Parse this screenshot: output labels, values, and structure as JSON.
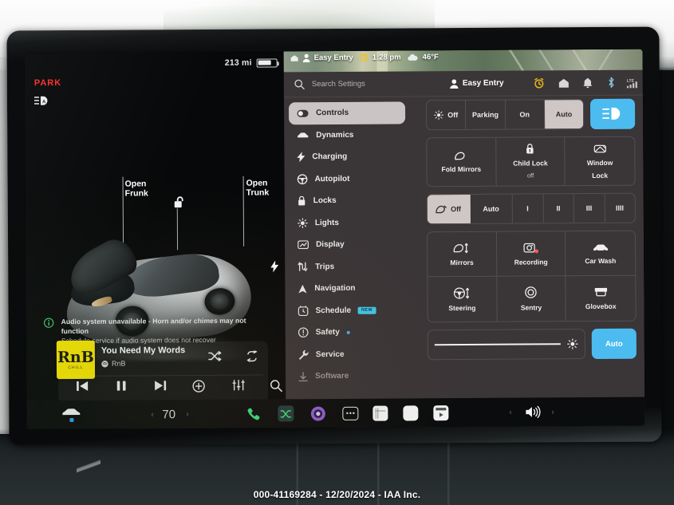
{
  "photo": {
    "watermark": "000-41169284 - 12/20/2024 - IAA Inc."
  },
  "drive_panel": {
    "range": "213 mi",
    "gear": "PARK",
    "autolight_icon": "auto-highbeam-icon",
    "battery_icon": "battery-icon",
    "charge_port_icon": "charge-bolt-icon",
    "labels": {
      "frunk_line1": "Open",
      "frunk_line2": "Frunk",
      "trunk_line1": "Open",
      "trunk_line2": "Trunk",
      "lock_icon": "lock-icon"
    },
    "notice": {
      "icon": "info-icon",
      "title": "Audio system unavailable - Horn and/or chimes may not function",
      "subtitle": "Schedule service if audio system does not recover"
    },
    "media": {
      "album_art_text": "RnB",
      "album_art_sub": "CHILL",
      "track_title": "You Need My Words",
      "source": "RnB",
      "source_icon": "spotify-icon",
      "shuffle_icon": "shuffle-icon",
      "repeat_icon": "repeat-icon",
      "prev_icon": "previous-track-icon",
      "pause_icon": "pause-icon",
      "next_icon": "next-track-icon",
      "add_icon": "add-circle-icon",
      "equalizer_icon": "equalizer-icon",
      "search_icon": "search-icon"
    }
  },
  "settings": {
    "map_status": {
      "place_icon": "place-icon",
      "person_icon": "person-icon",
      "profile": "Easy Entry",
      "clock_icon": "alarm-clock-icon",
      "time": "1:28 pm",
      "weather_icon": "cloud-icon",
      "temperature": "46°F"
    },
    "search": {
      "icon": "search-icon",
      "placeholder": "Search Settings"
    },
    "profile": {
      "icon": "person-icon",
      "name": "Easy Entry"
    },
    "status_icons": [
      {
        "name": "alarm-clock-icon",
        "label": "Alarm"
      },
      {
        "name": "home-icon",
        "label": "Home"
      },
      {
        "name": "bell-icon",
        "label": "Notifications"
      },
      {
        "name": "bluetooth-icon",
        "label": "Bluetooth"
      },
      {
        "name": "lte-signal-icon",
        "label": "LTE"
      }
    ],
    "nav_items": [
      {
        "label": "Controls",
        "icon": "toggle-icon",
        "active": true
      },
      {
        "label": "Dynamics",
        "icon": "car-icon",
        "active": false
      },
      {
        "label": "Charging",
        "icon": "bolt-icon",
        "active": false
      },
      {
        "label": "Autopilot",
        "icon": "steering-icon",
        "active": false
      },
      {
        "label": "Locks",
        "icon": "lock-icon",
        "active": false
      },
      {
        "label": "Lights",
        "icon": "sun-icon",
        "active": false
      },
      {
        "label": "Display",
        "icon": "display-icon",
        "active": false
      },
      {
        "label": "Trips",
        "icon": "trips-icon",
        "active": false
      },
      {
        "label": "Navigation",
        "icon": "navigation-icon",
        "active": false
      },
      {
        "label": "Schedule",
        "icon": "schedule-icon",
        "active": false,
        "badge": "NEW"
      },
      {
        "label": "Safety",
        "icon": "safety-icon",
        "active": false,
        "dot": true
      },
      {
        "label": "Service",
        "icon": "wrench-icon",
        "active": false
      },
      {
        "label": "Software",
        "icon": "download-icon",
        "active": false,
        "dim": true
      }
    ],
    "lights_row": {
      "options": [
        {
          "label": "Off",
          "icon": "headlight-off-icon",
          "selected": false
        },
        {
          "label": "Parking",
          "icon": null,
          "selected": false
        },
        {
          "label": "On",
          "icon": null,
          "selected": false
        },
        {
          "label": "Auto",
          "icon": null,
          "selected": true
        }
      ],
      "highbeam_button_icon": "highbeam-icon"
    },
    "quick_cards": [
      {
        "label": "Fold Mirrors",
        "sub": "",
        "icon": "mirror-icon"
      },
      {
        "label": "Child Lock",
        "sub": "off",
        "icon": "child-lock-icon"
      },
      {
        "label": "Window",
        "label2": "Lock",
        "sub": "",
        "icon": "window-lock-icon"
      }
    ],
    "wiper_row": {
      "options": [
        {
          "label": "Off",
          "icon": "wiper-icon",
          "selected": true
        },
        {
          "label": "Auto",
          "icon": null,
          "selected": false
        },
        {
          "label": "I",
          "icon": null,
          "selected": false
        },
        {
          "label": "II",
          "icon": null,
          "selected": false
        },
        {
          "label": "III",
          "icon": null,
          "selected": false
        },
        {
          "label": "IIII",
          "icon": null,
          "selected": false
        }
      ]
    },
    "tiles": [
      {
        "label": "Mirrors",
        "icon": "mirror-adjust-icon"
      },
      {
        "label": "Recording",
        "icon": "dashcam-icon"
      },
      {
        "label": "Car Wash",
        "icon": "car-wash-icon"
      },
      {
        "label": "Steering",
        "icon": "steering-adjust-icon"
      },
      {
        "label": "Sentry",
        "icon": "sentry-icon"
      },
      {
        "label": "Glovebox",
        "icon": "glovebox-icon"
      }
    ],
    "brightness": {
      "slider_icon": "brightness-icon",
      "slider_percent": 96,
      "auto_label": "Auto"
    }
  },
  "taskbar": {
    "car_icon": "car-icon",
    "climate_temp": "70",
    "left_arrow": "‹",
    "right_arrow": "›",
    "phone_icon": "phone-icon",
    "shuffle_icon": "shuffle-app-icon",
    "camera_icon": "camera-app-icon",
    "more_icon": "more-icon",
    "apps": [
      {
        "name": "calendar-app-icon"
      },
      {
        "name": "browser-app-icon"
      },
      {
        "name": "theater-app-icon"
      }
    ],
    "volume_icon": "volume-icon"
  },
  "colors": {
    "accent_blue": "#4cbcf0",
    "badge_cyan": "#41c7ea",
    "park_red": "#ff2b2b",
    "album_yellow": "#f5e400",
    "panel_bg": "#3e393b",
    "selected_gray": "#cfc7c5"
  }
}
